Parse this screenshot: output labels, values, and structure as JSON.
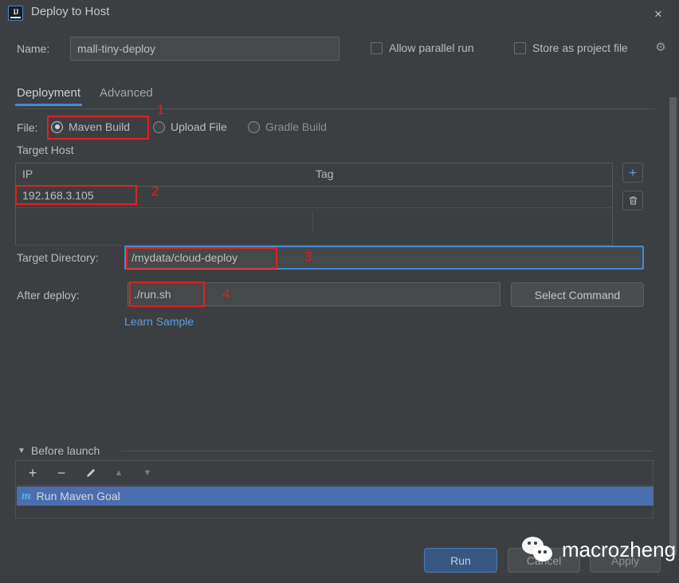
{
  "window": {
    "title": "Deploy to Host",
    "app_icon": "intellij-idea-icon",
    "close_label": "×"
  },
  "name_row": {
    "label": "Name:",
    "value": "mall-tiny-deploy",
    "placeholder": "",
    "allow_parallel_run": "Allow parallel run",
    "store_as_project_file": "Store as project file",
    "gear_icon": "⚙"
  },
  "tabs": [
    {
      "label": "Deployment",
      "active": true
    },
    {
      "label": "Advanced",
      "active": false
    }
  ],
  "file_row": {
    "label": "File:",
    "options": [
      {
        "label": "Maven Build",
        "selected": true
      },
      {
        "label": "Upload File",
        "selected": false
      },
      {
        "label": "Gradle Build",
        "selected": false
      }
    ]
  },
  "target_host": {
    "section_label": "Target Host",
    "columns": [
      "IP",
      "Tag"
    ],
    "rows": [
      {
        "ip": "192.168.3.105",
        "tag": ""
      }
    ],
    "add_icon": "+",
    "delete_icon": "trash-icon"
  },
  "target_directory": {
    "label": "Target Directory:",
    "value": "/mydata/cloud-deploy"
  },
  "after_deploy": {
    "label": "After deploy:",
    "value": "./run.sh",
    "select_command_label": "Select Command",
    "learn_sample_label": "Learn Sample"
  },
  "before_launch": {
    "title": "Before launch",
    "collapse_arrow": "▼",
    "toolbar": [
      {
        "name": "add",
        "glyph": "+"
      },
      {
        "name": "remove",
        "glyph": "−"
      },
      {
        "name": "edit",
        "glyph": "✐"
      },
      {
        "name": "move-up",
        "glyph": "▲"
      },
      {
        "name": "move-down",
        "glyph": "▼"
      }
    ],
    "items": [
      {
        "icon": "m",
        "label": "Run Maven Goal",
        "selected": true
      }
    ]
  },
  "buttons": {
    "run": "Run",
    "cancel": "Cancel",
    "apply": "Apply"
  },
  "annotations": [
    {
      "number": "1"
    },
    {
      "number": "2"
    },
    {
      "number": "3"
    },
    {
      "number": "4"
    }
  ],
  "watermark": {
    "text": "macrozheng",
    "logo": "wechat-logo"
  },
  "colors": {
    "background": "#3c3f41",
    "field_background": "#45494a",
    "accent_blue": "#4a88d6",
    "run_button": "#365880",
    "selection_blue": "#4b6eaf",
    "link_blue": "#5b9fe0",
    "annotation_red": "#e02020",
    "maven_icon": "#49b6e8",
    "text_primary": "#bbbbbb"
  }
}
